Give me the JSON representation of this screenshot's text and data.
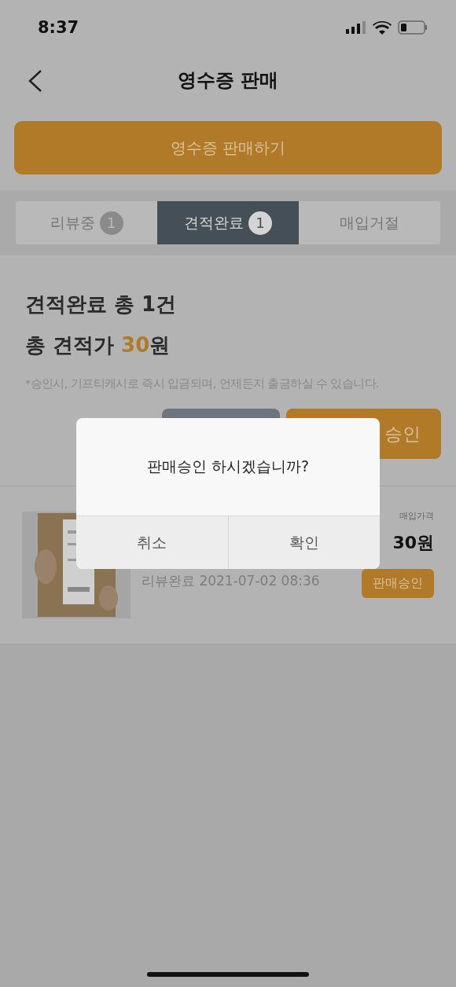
{
  "status_bar": {
    "time": "8:37"
  },
  "header": {
    "title": "영수증 판매"
  },
  "primary_button": "영수증 판매하기",
  "tabs": [
    {
      "label": "리뷰중",
      "count": "1",
      "selected": false
    },
    {
      "label": "견적완료",
      "count": "1",
      "selected": true
    },
    {
      "label": "매입거절",
      "selected": false
    }
  ],
  "summary": {
    "count_line": "견적완료 총 1건",
    "total_prefix": "총 견적가 ",
    "total_amount": "30",
    "total_suffix": "원",
    "note": "*승인시, 기프티캐시로 즉시 입금되며, 언제든지 출금하실 수 있습니다.",
    "approve_button_visible": "승인"
  },
  "items": [
    {
      "kind": "picture",
      "date": "리뷰완료 2021-07-02 08:36",
      "price_label": "매입가격",
      "price": "30원",
      "action": "판매승인"
    }
  ],
  "dialog": {
    "message": "판매승인 하시겠습니까?",
    "buttons": [
      "취소",
      "확인"
    ]
  }
}
